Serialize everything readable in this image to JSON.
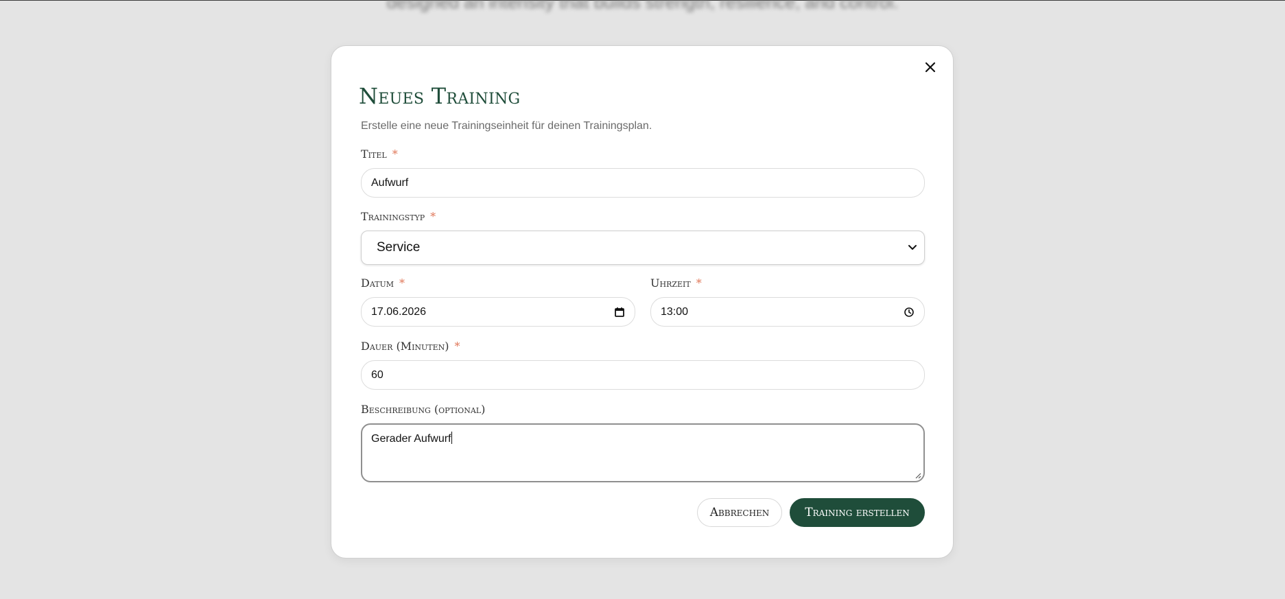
{
  "background": {
    "blurred_text": "designed an intensity that builds strength, resilience, and control."
  },
  "dialog": {
    "title": "Neues Training",
    "subtitle": "Erstelle eine neue Trainingseinheit für deinen Trainingsplan.",
    "close_icon": "close-icon",
    "required_marker": "*",
    "fields": {
      "titel": {
        "label": "Titel",
        "value": "Aufwurf"
      },
      "trainingstyp": {
        "label": "Trainingstyp",
        "selected": "Service"
      },
      "datum": {
        "label": "Datum",
        "value": "17.06.2026"
      },
      "uhrzeit": {
        "label": "Uhrzeit",
        "value": "13:00"
      },
      "dauer": {
        "label": "Dauer (Minuten)",
        "value": "60"
      },
      "beschreibung": {
        "label": "Beschreibung (optional)",
        "value": "Gerader Aufwurf"
      }
    },
    "buttons": {
      "cancel": "Abbrechen",
      "submit": "Training erstellen"
    }
  },
  "colors": {
    "accent": "#1f4d3a",
    "required": "#e0785a",
    "overlay": "#e4e4e4"
  }
}
